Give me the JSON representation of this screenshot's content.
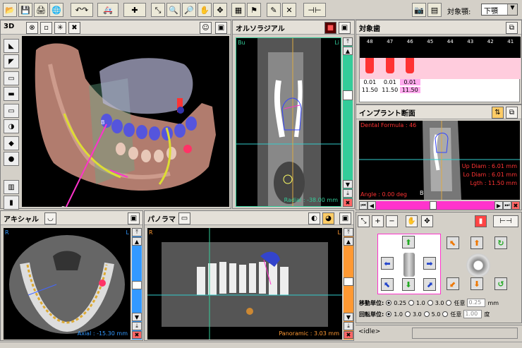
{
  "toolbar": {
    "target_label": "対象顎:",
    "target_value": "下顎"
  },
  "panel3d": {
    "title": "3D",
    "label_b": "B"
  },
  "ortho": {
    "title": "オルソラジアル",
    "corner_left": "Bu",
    "corner_right": "Li",
    "readout": "Radial : -38.00 mm"
  },
  "target_teeth": {
    "title": "対象歯",
    "headers": [
      "48",
      "47",
      "46",
      "45",
      "44",
      "43",
      "42",
      "41"
    ],
    "implants": [
      {
        "v1": "0.01",
        "v2": "11.50"
      },
      {
        "v1": "0.01",
        "v2": "11.50"
      },
      {
        "v1": "0.01",
        "v2": "11.50"
      }
    ]
  },
  "implant_section": {
    "title": "インプラント断面",
    "dental_formula": "Dental Formula : 46",
    "up_diam": "Up Diam : 6.01 mm",
    "lo_diam": "Lo Diam : 6.01 mm",
    "length": "Lgth : 11.50 mm",
    "angle": "Angle : 0.00 deg",
    "label_b": "B"
  },
  "axial": {
    "title": "アキシャル",
    "corner_left": "R",
    "corner_right": "L",
    "readout": "Axial : -15.30 mm"
  },
  "panorama": {
    "title": "パノラマ",
    "corner_left": "R",
    "corner_right": "L",
    "readout": "Panoramic : 3.03 mm"
  },
  "controls": {
    "move_label": "移動単位:",
    "move_options": [
      "0.25",
      "1.0",
      "3.0",
      "任意"
    ],
    "move_custom": "0.25",
    "move_unit": "mm",
    "rot_label": "回転単位:",
    "rot_options": [
      "1.0",
      "3.0",
      "5.0",
      "任意"
    ],
    "rot_custom": "1.00",
    "rot_unit": "度"
  },
  "status": {
    "text": "<idle>"
  },
  "colors": {
    "accent_green": "#33cc99",
    "accent_blue": "#3399ff",
    "accent_orange": "#ff9933",
    "magenta": "#ff33cc",
    "implant_red": "#ff3333"
  }
}
